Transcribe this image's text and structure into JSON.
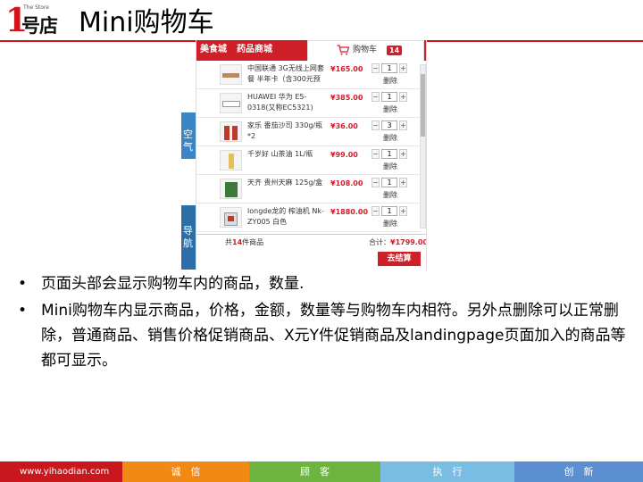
{
  "logo": {
    "numeral": "1",
    "tagline": "The Store",
    "mark": "号店"
  },
  "slide": {
    "title": "Mini购物车"
  },
  "background_fragments": [
    "空气",
    "导航"
  ],
  "mini_cart": {
    "nav_links": [
      "美食城",
      "药品商城"
    ],
    "cart_tab": {
      "label": "购物车",
      "badge": "14",
      "icon": "shopping-cart-icon"
    },
    "items": [
      {
        "name": "中国联通 3G无线上网套餐 半年卡（含300元预",
        "price": "¥165.00",
        "qty": "1",
        "delete": "删除",
        "thumb": "product-image-card"
      },
      {
        "name": "HUAWEI 华为 E5-0318(又称EC5321)",
        "price": "¥385.00",
        "qty": "1",
        "delete": "删除",
        "thumb": "product-image-router"
      },
      {
        "name": "家乐 番茄沙司 330g/瓶*2",
        "price": "¥36.00",
        "qty": "3",
        "delete": "删除",
        "thumb": "product-image-bottles"
      },
      {
        "name": "千岁好 山茶油 1L/瓶",
        "price": "¥99.00",
        "qty": "1",
        "delete": "删除",
        "thumb": "product-image-oil"
      },
      {
        "name": "天齐 贵州天麻 125g/盒",
        "price": "¥108.00",
        "qty": "1",
        "delete": "删除",
        "thumb": "product-image-box"
      },
      {
        "name": "longde龙的 榨油机 Nk-ZY005 白色",
        "price": "¥1880.00",
        "qty": "1",
        "delete": "删除",
        "thumb": "product-image-machine"
      }
    ],
    "minus_symbol": "−",
    "plus_symbol": "+",
    "summary": {
      "prefix": "共",
      "count": "14",
      "suffix": "件商品",
      "total_label": "合计：",
      "total_value": "¥1799.00"
    },
    "checkout_label": "去结算",
    "colors": {
      "brand_red": "#cf1f28"
    }
  },
  "bullets": {
    "marker": "•",
    "items": [
      "页面头部会显示购物车内的商品，数量.",
      "Mini购物车内显示商品，价格，金额，数量等与购物车内相符。另外点删除可以正常删除，普通商品、销售价格促销商品、X元Y件促销商品及landingpage页面加入的商品等都可显示。"
    ]
  },
  "footer": {
    "url": "www.yihaodian.com",
    "values": [
      "诚　信",
      "顾　客",
      "执　行",
      "创　新"
    ],
    "colors": [
      "#c8171d",
      "#f08a15",
      "#6cb43f",
      "#79bde3",
      "#5b8fd0"
    ]
  }
}
